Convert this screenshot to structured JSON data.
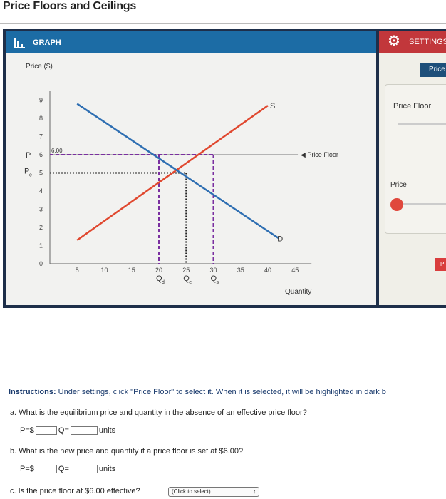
{
  "page": {
    "title": "Price Floors and Ceilings"
  },
  "graph_panel": {
    "header_label": "GRAPH"
  },
  "settings_panel": {
    "header_label": "SETTINGS",
    "price_tab_label": "Price",
    "price_floor_label": "Price Floor",
    "price_label": "Price",
    "red_tab_label": "P"
  },
  "chart_data": {
    "type": "line",
    "ylabel": "Price ($)",
    "xlabel": "Quantity",
    "xlim": [
      0,
      50
    ],
    "ylim": [
      0,
      10
    ],
    "x_ticks": [
      5,
      10,
      15,
      20,
      25,
      30,
      35,
      40,
      45
    ],
    "y_ticks": [
      1,
      2,
      3,
      4,
      5,
      6,
      7,
      8,
      9
    ],
    "series": [
      {
        "name": "S",
        "x": [
          5,
          40
        ],
        "y": [
          1.3,
          8.7
        ],
        "color": "#e0482f"
      },
      {
        "name": "D",
        "x": [
          5,
          42
        ],
        "y": [
          8.8,
          1.4
        ],
        "color": "#2f6fb2"
      }
    ],
    "price_floor": {
      "label": "Price Floor",
      "value": 6.0,
      "value_label": "6.00"
    },
    "y_axis_marks": {
      "p_label": "P",
      "pe_label": "P",
      "pe_sub": "e"
    },
    "q_markers": [
      {
        "x": 20,
        "label": "Q",
        "sub": "d"
      },
      {
        "x": 25,
        "label": "Q",
        "sub": "e"
      },
      {
        "x": 30,
        "label": "Q",
        "sub": "s"
      }
    ],
    "equilibrium": {
      "x": 25,
      "y": 5
    }
  },
  "instructions": {
    "bold": "Instructions:",
    "text": " Under settings, click \"Price Floor\" to select it. When it is selected, it will be highlighted in dark b"
  },
  "questions": {
    "a": "a. What is the equilibrium price and quantity in the absence of an effective price floor?",
    "b": "b. What is the new price and quantity if a price floor is set at $6.00?",
    "c": "c. Is the price floor at $6.00 effective?",
    "p_prefix": "P=$",
    "q_prefix": "Q=",
    "units": "units",
    "select_placeholder": "(Click to select)"
  },
  "colors": {
    "frame": "#1e2f4a",
    "graph_header": "#1c6ca5",
    "settings_header": "#c2373b",
    "supply": "#e0482f",
    "demand": "#2f6fb2"
  }
}
